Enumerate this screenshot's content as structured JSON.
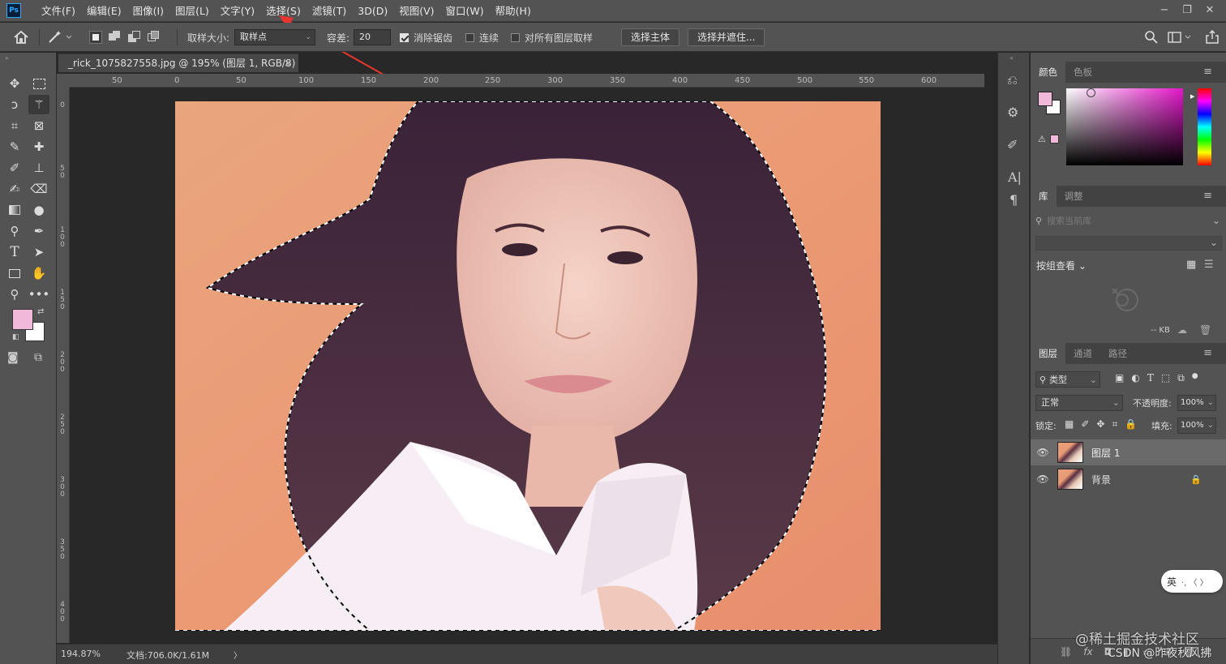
{
  "app": {
    "logo_text": "Ps"
  },
  "menu": {
    "items": [
      "文件(F)",
      "编辑(E)",
      "图像(I)",
      "图层(L)",
      "文字(Y)",
      "选择(S)",
      "滤镜(T)",
      "3D(D)",
      "视图(V)",
      "窗口(W)",
      "帮助(H)"
    ],
    "window_controls": [
      "−",
      "❐",
      "✕"
    ]
  },
  "options": {
    "sample_size_label": "取样大小:",
    "sample_size_value": "取样点",
    "tolerance_label": "容差:",
    "tolerance_value": "20",
    "anti_alias_label": "消除锯齿",
    "anti_alias_checked": true,
    "contiguous_label": "连续",
    "contiguous_checked": false,
    "all_layers_label": "对所有图层取样",
    "all_layers_checked": false,
    "select_subject_label": "选择主体",
    "select_mask_label": "选择并遮住..."
  },
  "document": {
    "tab_title": "_rick_1075827558.jpg @ 195% (图层 1, RGB/8) *",
    "close_glyph": "×"
  },
  "ruler": {
    "h_labels": [
      "50",
      "0",
      "50",
      "100",
      "150",
      "200",
      "250",
      "300",
      "350",
      "400",
      "450",
      "500",
      "550",
      "600"
    ],
    "v_labels": [
      "0",
      "5\n0",
      "1\n0\n0",
      "1\n5\n0",
      "2\n0\n0",
      "2\n5\n0",
      "3\n0\n0",
      "3\n5\n0",
      "4\n0\n0"
    ]
  },
  "status": {
    "zoom": "194.87%",
    "doc_info": "文档:706.0K/1.61M",
    "arrow": "〉"
  },
  "color_panel": {
    "tabs": [
      "颜色",
      "色板"
    ],
    "foreground_color": "#f2b8da",
    "background_color": "#ffffff"
  },
  "library_panel": {
    "tabs": [
      "库",
      "调整"
    ],
    "search_placeholder": "搜索当前库",
    "group_view_label": "按组查看",
    "size_label": "-- KB"
  },
  "layers_panel": {
    "tabs": [
      "图层",
      "通道",
      "路径"
    ],
    "filter_label": "类型",
    "blend_mode": "正常",
    "opacity_label": "不透明度:",
    "opacity_value": "100%",
    "lock_label": "锁定:",
    "fill_label": "填充:",
    "fill_value": "100%",
    "layers": [
      {
        "name": "图层 1",
        "selected": true,
        "locked": false
      },
      {
        "name": "背景",
        "selected": false,
        "locked": true
      }
    ]
  },
  "ime": {
    "label": "英",
    "extra": "·, 〈 〉"
  },
  "watermark": {
    "line1": "@稀土掘金技术社区",
    "line2": "CSDN @昨夜秋风拂"
  }
}
